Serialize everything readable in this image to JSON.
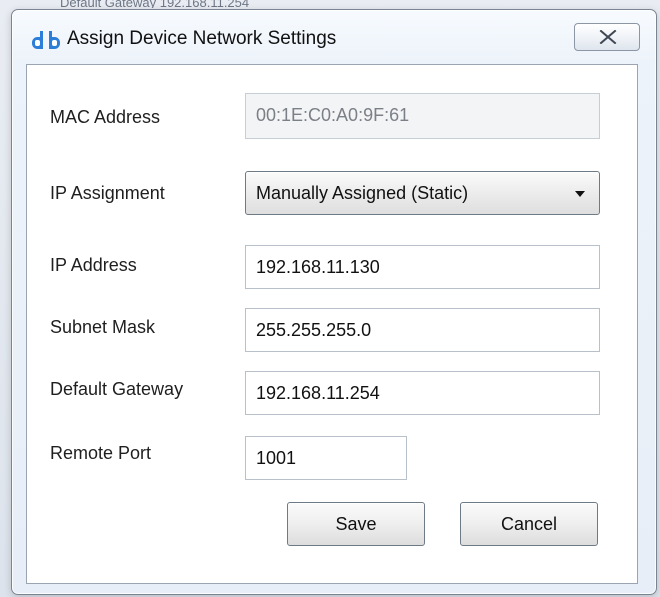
{
  "background": {
    "partial_text": "Default Gateway    192.168.11.254"
  },
  "window": {
    "title": "Assign Device Network Settings",
    "icon": "db-app-icon",
    "close_icon": "close-icon"
  },
  "form": {
    "mac_label": "MAC Address",
    "mac_value": "00:1E:C0:A0:9F:61",
    "ip_assignment_label": "IP Assignment",
    "ip_assignment_value": "Manually Assigned (Static)",
    "ip_address_label": "IP Address",
    "ip_address_value": "192.168.11.130",
    "subnet_mask_label": "Subnet Mask",
    "subnet_mask_value": "255.255.255.0",
    "default_gateway_label": "Default Gateway",
    "default_gateway_value": "192.168.11.254",
    "remote_port_label": "Remote Port",
    "remote_port_value": "1001"
  },
  "buttons": {
    "save": "Save",
    "cancel": "Cancel"
  },
  "colors": {
    "app_icon_blue": "#2d7ed8",
    "window_border": "#7b8591",
    "client_border": "#9ba5b2"
  }
}
